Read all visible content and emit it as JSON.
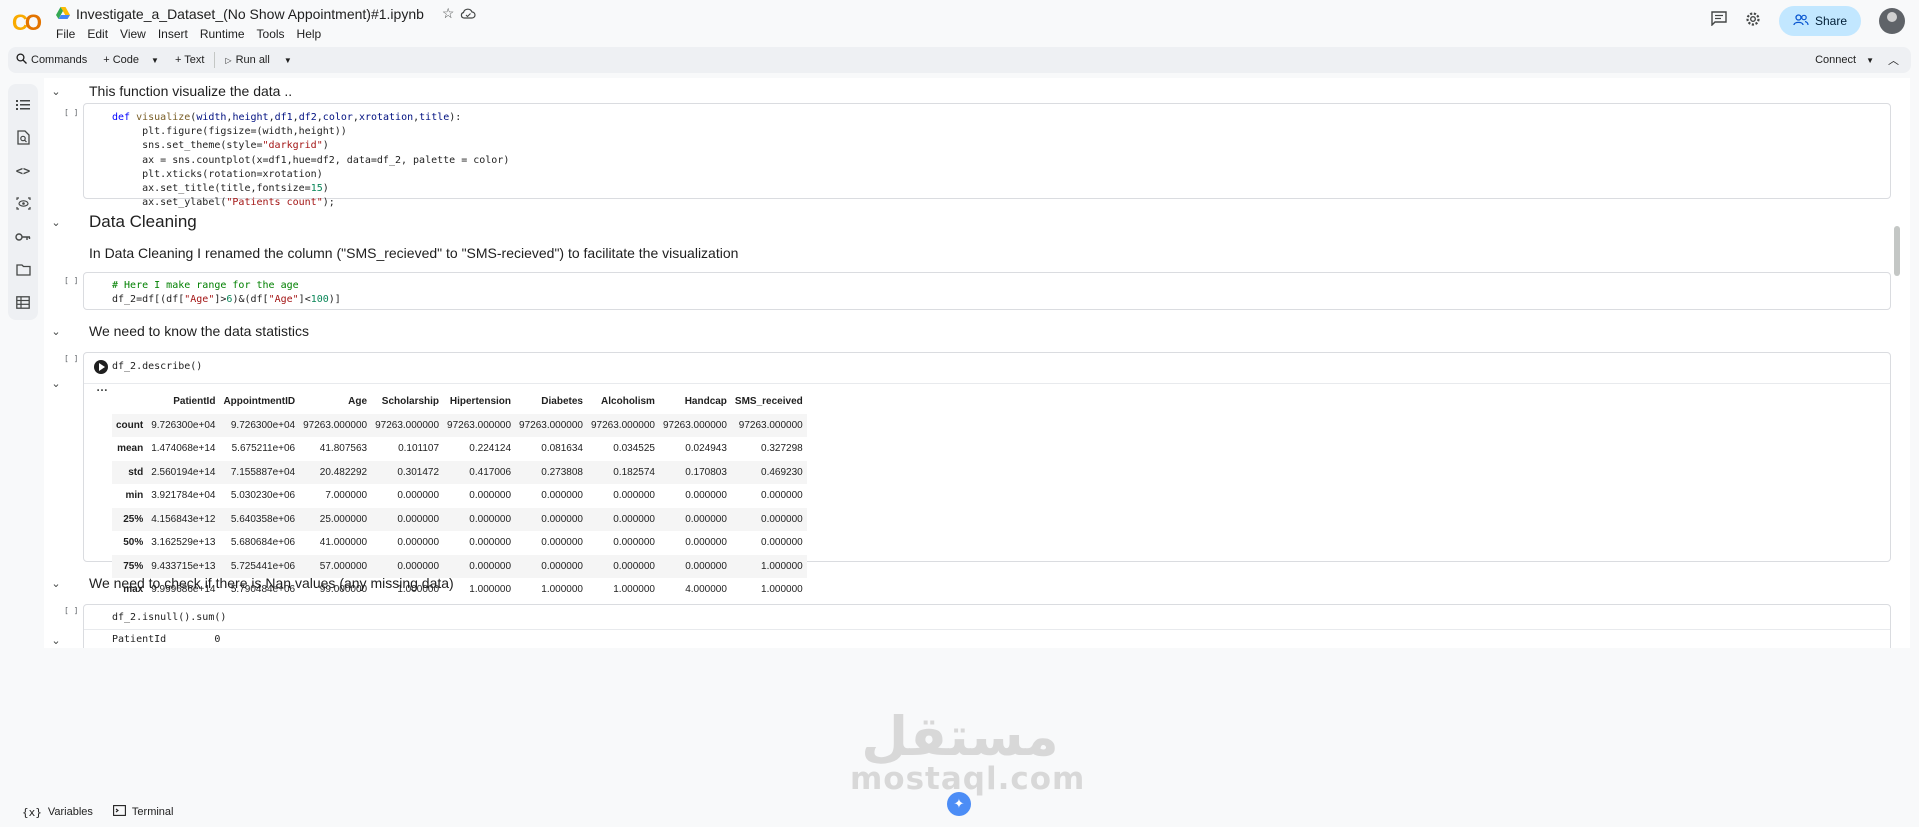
{
  "header": {
    "logo": "CO",
    "notebook_title": "Investigate_a_Dataset_(No Show Appointment)#1.ipynb",
    "menu": [
      "File",
      "Edit",
      "View",
      "Insert",
      "Runtime",
      "Tools",
      "Help"
    ],
    "share_label": "Share"
  },
  "toolbar": {
    "commands_label": "Commands",
    "code_label": "+ Code",
    "text_label": "+ Text",
    "run_all_label": "Run all",
    "connect_label": "Connect"
  },
  "cells": {
    "md1": "This function visualize the data ..",
    "code1_exec": "[ ]",
    "md2": "Data Cleaning",
    "md3": "In Data Cleaning I renamed the column (\"SMS_recieved\" to \"SMS-recieved\") to facilitate the visualization",
    "code2_exec": "[ ]",
    "md4": "We need to know the data statistics",
    "code3_exec": "[ ]",
    "code3_src": "df_2.describe()",
    "md5": "We need to check if there is Nan values (any missing data)",
    "code4_exec": "[ ]",
    "code4_src": "df_2.isnull().sum()",
    "code4_out": "PatientId        0"
  },
  "describe_table": {
    "columns": [
      "",
      "PatientId",
      "AppointmentID",
      "Age",
      "Scholarship",
      "Hipertension",
      "Diabetes",
      "Alcoholism",
      "Handcap",
      "SMS_received"
    ],
    "rows": [
      [
        "count",
        "9.726300e+04",
        "9.726300e+04",
        "97263.000000",
        "97263.000000",
        "97263.000000",
        "97263.000000",
        "97263.000000",
        "97263.000000",
        "97263.000000"
      ],
      [
        "mean",
        "1.474068e+14",
        "5.675211e+06",
        "41.807563",
        "0.101107",
        "0.224124",
        "0.081634",
        "0.034525",
        "0.024943",
        "0.327298"
      ],
      [
        "std",
        "2.560194e+14",
        "7.155887e+04",
        "20.482292",
        "0.301472",
        "0.417006",
        "0.273808",
        "0.182574",
        "0.170803",
        "0.469230"
      ],
      [
        "min",
        "3.921784e+04",
        "5.030230e+06",
        "7.000000",
        "0.000000",
        "0.000000",
        "0.000000",
        "0.000000",
        "0.000000",
        "0.000000"
      ],
      [
        "25%",
        "4.156843e+12",
        "5.640358e+06",
        "25.000000",
        "0.000000",
        "0.000000",
        "0.000000",
        "0.000000",
        "0.000000",
        "0.000000"
      ],
      [
        "50%",
        "3.162529e+13",
        "5.680684e+06",
        "41.000000",
        "0.000000",
        "0.000000",
        "0.000000",
        "0.000000",
        "0.000000",
        "0.000000"
      ],
      [
        "75%",
        "9.433715e+13",
        "5.725441e+06",
        "57.000000",
        "0.000000",
        "0.000000",
        "0.000000",
        "0.000000",
        "0.000000",
        "1.000000"
      ],
      [
        "max",
        "9.999686e+14",
        "5.790484e+06",
        "99.000000",
        "1.000000",
        "1.000000",
        "1.000000",
        "1.000000",
        "4.000000",
        "1.000000"
      ]
    ]
  },
  "bottom": {
    "variables_label": "Variables",
    "terminal_label": "Terminal"
  },
  "watermark": {
    "arabic": "مستقل",
    "latin": "mostaql.com"
  },
  "colors": {
    "accent": "#c2e7ff",
    "keyword": "#0000ff",
    "string": "#a31515",
    "comment": "#008000",
    "number": "#098658"
  }
}
